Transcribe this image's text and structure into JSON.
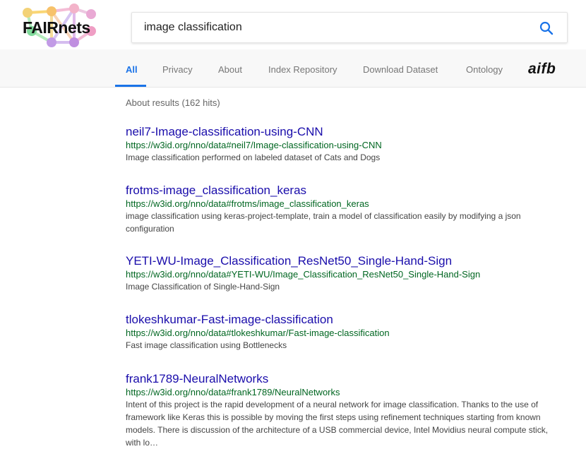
{
  "header": {
    "logo_text": "FAIRnets",
    "search_value": "image classification",
    "search_icon": "search-icon"
  },
  "nav": {
    "tabs": [
      {
        "label": "All",
        "active": true
      },
      {
        "label": "Privacy"
      },
      {
        "label": "About"
      },
      {
        "label": "Index Repository"
      },
      {
        "label": "Download Dataset"
      },
      {
        "label": "Ontology"
      }
    ],
    "partner_logo": "aifb"
  },
  "results": {
    "stats": "About results (162 hits)",
    "items": [
      {
        "title": "neil7-Image-classification-using-CNN",
        "url": "https://w3id.org/nno/data#neil7/Image-classification-using-CNN",
        "desc": "Image classification performed on labeled dataset of Cats and Dogs"
      },
      {
        "title": "frotms-image_classification_keras",
        "url": "https://w3id.org/nno/data#frotms/image_classification_keras",
        "desc": "image classification using keras-project-template, train a model of classification easily by modifying a json configuration"
      },
      {
        "title": "YETI-WU-Image_Classification_ResNet50_Single-Hand-Sign",
        "url": "https://w3id.org/nno/data#YETI-WU/Image_Classification_ResNet50_Single-Hand-Sign",
        "desc": "Image Classification of Single-Hand-Sign"
      },
      {
        "title": "tlokeshkumar-Fast-image-classification",
        "url": "https://w3id.org/nno/data#tlokeshkumar/Fast-image-classification",
        "desc": "Fast image classification using Bottlenecks"
      },
      {
        "title": "frank1789-NeuralNetworks",
        "url": "https://w3id.org/nno/data#frank1789/NeuralNetworks",
        "desc": "Intent of this project is the rapid development of a neural network for image classification. Thanks to the use of framework like Keras this is possible by moving the first steps using refinement techniques starting from known models. There is discussion of the architecture of a USB commercial device, Intel Movidius neural compute stick, with lo…"
      }
    ]
  },
  "colors": {
    "accent": "#1a73e8",
    "title_link": "#1a0dab",
    "url_green": "#006621"
  }
}
